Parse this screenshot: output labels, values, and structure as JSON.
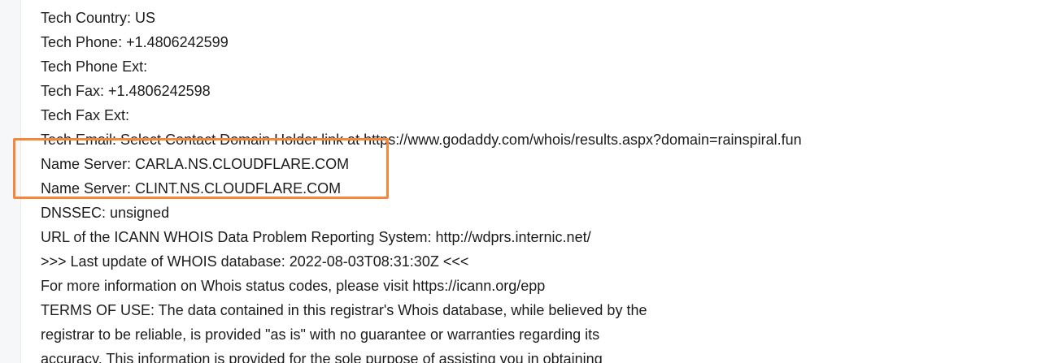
{
  "whois": {
    "lines": [
      "Tech Country: US",
      "Tech Phone: +1.4806242599",
      "Tech Phone Ext:",
      "Tech Fax: +1.4806242598",
      "Tech Fax Ext:",
      "Tech Email: Select Contact Domain Holder link at https://www.godaddy.com/whois/results.aspx?domain=rainspiral.fun",
      "Name Server: CARLA.NS.CLOUDFLARE.COM",
      "Name Server: CLINT.NS.CLOUDFLARE.COM",
      "DNSSEC: unsigned",
      "URL of the ICANN WHOIS Data Problem Reporting System: http://wdprs.internic.net/",
      ">>> Last update of WHOIS database: 2022-08-03T08:31:30Z <<<",
      "For more information on Whois status codes, please visit https://icann.org/epp",
      "TERMS OF USE: The data contained in this registrar's Whois database, while believed by the",
      "registrar to be reliable, is provided \"as is\" with no guarantee or warranties regarding its",
      "accuracy. This information is provided for the sole purpose of assisting you in obtaining"
    ]
  },
  "colors": {
    "highlight": "#f5873a",
    "text": "#1c1c1c"
  }
}
